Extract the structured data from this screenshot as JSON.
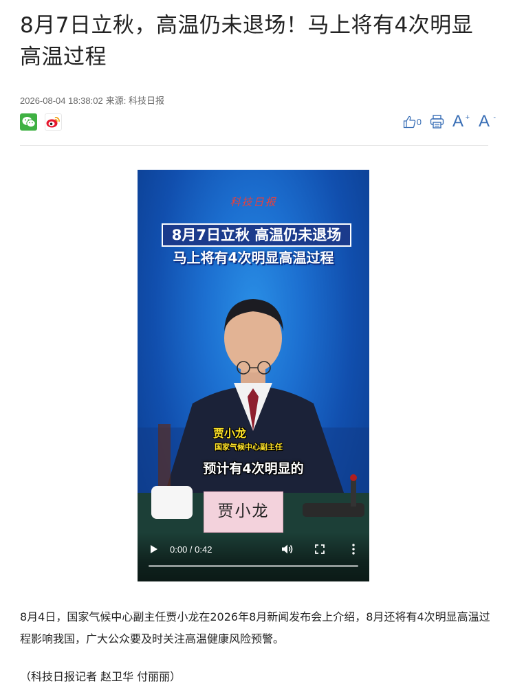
{
  "article": {
    "title": "8月7日立秋，高温仍未退场！马上将有4次明显高温过程",
    "datetime": "2026-08-04 18:38:02",
    "source_label": "来源:",
    "source": "科技日报",
    "body": "8月4日，国家气候中心副主任贾小龙在2026年8月新闻发布会上介绍，8月还将有4次明显高温过程影响我国，广大公众要及时关注高温健康风险预警。",
    "byline": "（科技日报记者 赵卫华 付丽丽）"
  },
  "share": {
    "wechat_icon": "wechat-icon",
    "weibo_icon": "weibo-icon"
  },
  "tools": {
    "like_count": "0",
    "like_icon": "thumbs-up-icon",
    "print_icon": "printer-icon",
    "font_larger": "A",
    "font_larger_sup": "+",
    "font_smaller": "A",
    "font_smaller_sup": "-"
  },
  "video": {
    "logo": "科技日报",
    "banner_line1": "8月7日立秋 高温仍未退场",
    "banner_line2": "马上将有4次明显高温过程",
    "speaker_name": "贾小龙",
    "speaker_role": "国家气候中心副主任",
    "subtitle": "预计有4次明显的",
    "nameplate": "贾小龙",
    "time": "0:00 / 0:42",
    "progress": 0,
    "colors": {
      "background": "#1c6fd0",
      "caption": "#ffe328"
    }
  },
  "colors": {
    "accent": "#3a6fb6",
    "text": "#222222",
    "meta": "#666666"
  }
}
